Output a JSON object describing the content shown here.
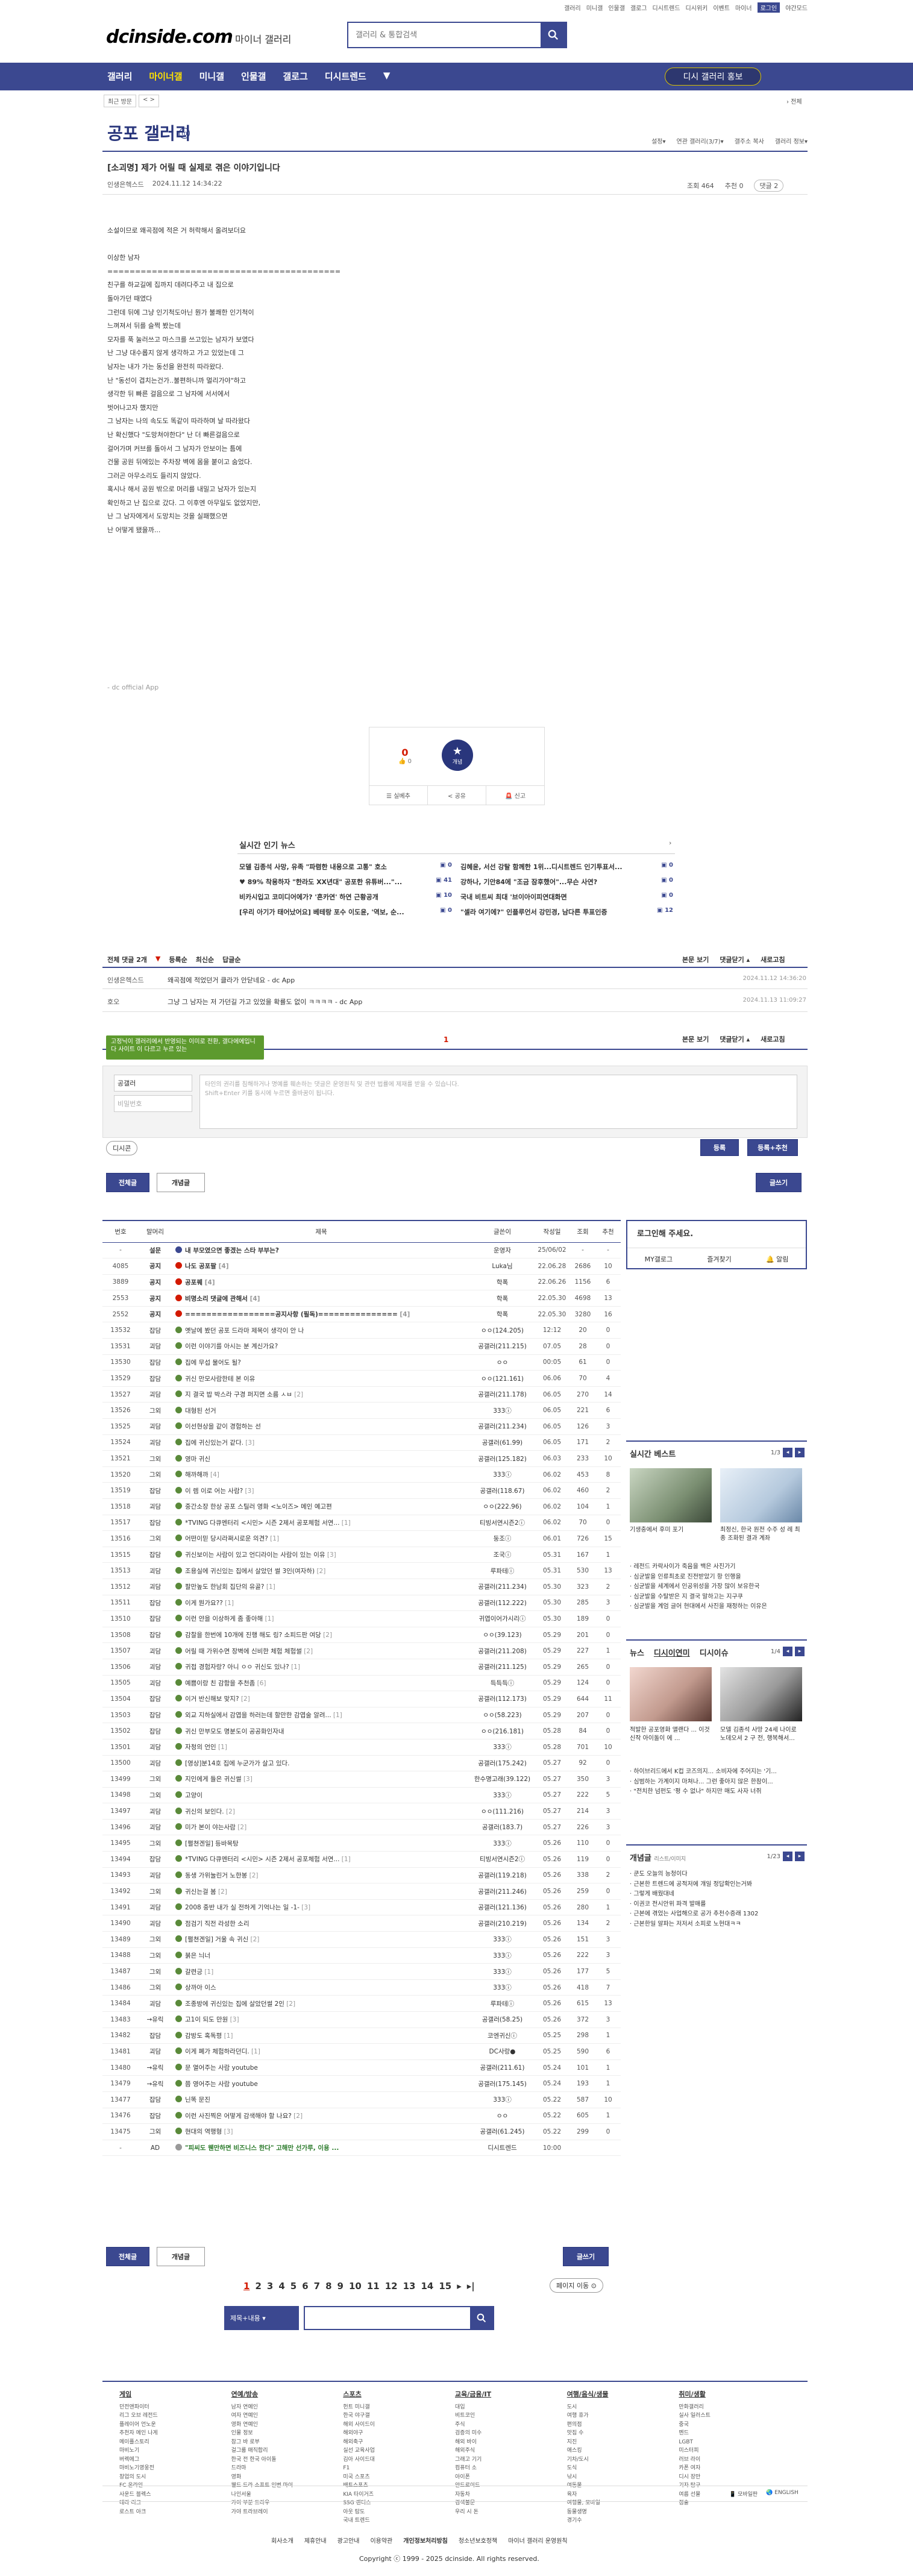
{
  "util_links": [
    "갤러리",
    "미니갤",
    "인물갤",
    "갤로그",
    "디시트렌드",
    "디시위키",
    "이벤트",
    "마이너",
    "로그인",
    "야간모드"
  ],
  "logo": {
    "text": "dcinside.com",
    "sub": "마이너 갤러리"
  },
  "search": {
    "placeholder": "갤러리 & 통합검색"
  },
  "gnb": {
    "items": [
      "갤러리",
      "마이너갤",
      "미니갤",
      "인물갤",
      "갤로그",
      "디시트렌드",
      "▼"
    ],
    "pill": "디시 갤러리 홍보"
  },
  "crumb": {
    "a": "최근 방문",
    "b": "< >"
  },
  "top_right": "› 전체",
  "gallery": {
    "title": "공포 갤러리",
    "icon": "m",
    "tools": [
      "설정▾",
      "연관 갤러리(3/7)▾",
      "갤주소 복사",
      "갤러리 정보▾"
    ]
  },
  "post": {
    "title": "[소괴명] 제가 어릴 때 실제로 겪은 이야기입니다",
    "writer": "인생은헥스드",
    "date": "2024.11.12 14:34:22",
    "views": "조회 464",
    "recommend": "추천 0",
    "comments": "댓글 2",
    "body": "소설이므로 왜곡점에 적은 거 허락해서 올려보더요\n\n이상한 남자\n==========================================\n친구를 하교길에 집까지 데려다주고 내 집으로\n돌아가던 때였다\n그런데 뒤에 그냥 인기척도아닌 뭔가 불쾌한 인기척이\n느껴져서 뒤를 슬쩍 봤는데\n모자를 푹 눌러쓰고 마스크를 쓰고있는 남자가 보였다\n난 그냥 대수롭지 않게 생각하고 가고 있었는데 그\n남자는 내가 가는 동선을 완전히 따라왔다.\n난 \"동선이 겹치는건가..불편하니까 멀리가야\"하고\n생각한 뒤 빠른 걸음으로 그 남자에 서서에서\n벗어나고자 했지만\n그 남자는 나의 속도도 똑같이 따라하며 날 따라왔다\n난 확신했다 \"도망쳐야한다\" 난 더 빠른걸음으로\n걸어가며 커브를 돌아서 그 남자가 안보이는 틈에\n건물 공원 뒤에있는 주차장 벽에 몸을 붙이고 숨었다.\n그러곤 아무소리도 들리지 않았다.\n혹시나 해서 공원 밖으로 머리를 내밀고 남자가 있는지\n확인하고 난 집으로 갔다. 그 이후엔 아무일도 없었지만,\n난 그 남자에게서 도망치는 것을 실패했으면\n난 어떻게 됐을까...",
    "source": "- dc official App"
  },
  "vote": {
    "up": "0",
    "up_sub": "👍 0",
    "circle": "개념",
    "circle_icon": "★",
    "acts": [
      "☰ 실베추",
      "< 공유",
      "🚨 신고"
    ]
  },
  "news": {
    "title": "실시간 인기 뉴스",
    "items": [
      {
        "t": "모델 김종석 사망, 유족 \"파렴한 내용으로 고통\" 호소",
        "n": "0"
      },
      {
        "t": "김혜윤, 서선 강탈 함께한 1위...디시트렌드 인기투표서...",
        "n": "0"
      },
      {
        "t": "♥ 89% 착용하자 \"한라도 XX년대\" 공포한 유튜버...\"...",
        "n": "41"
      },
      {
        "t": "강하나, 기안84에 \"조금 잠후했어\"...무슨 사연?",
        "n": "0"
      },
      {
        "t": "비카시입고 코미디어에가? '흔카연' 하연 근황공개",
        "n": "10"
      },
      {
        "t": "국내 비트씨 최대 '브이아이피연대화면",
        "n": "0"
      },
      {
        "t": "[우리 아기가 태어났어요] 베테랑 포수 이도윤, '역보, 순...",
        "n": "0"
      },
      {
        "t": "\"셀라 여기에?\" 인플루언서 강민경, 남다른 투표인증",
        "n": "12"
      }
    ]
  },
  "comments": {
    "head": [
      "전체 댓글 2개",
      "▼",
      "등록순",
      "최신순",
      "답글순"
    ],
    "head_right": [
      "본문 보기",
      "댓글닫기 ▴",
      "새로고침"
    ],
    "rows": [
      {
        "w": "인생은헥스드",
        "t": "왜곡점에 적었던거 클라가 안닫네요 - dc App",
        "d": "2024.11.12 14:36:20"
      },
      {
        "w": "호오",
        "t": "그냥 그 남자는 저 가던길 가고 있었을 확률도 없이 ㅋㅋㅋㅋ - dc App",
        "d": "2024.11.13 11:09:27"
      }
    ],
    "page": "1",
    "tools": [
      "본문 보기",
      "댓글닫기 ▴",
      "새로고침"
    ],
    "tooltip": "고정닉이 갤러리에서 반영되는 이미로 전환, 갤다에에입니다 사이트 이 다르고 누르 있는",
    "name": "공갤러",
    "pw_placeholder": "비밀번호",
    "ta_placeholder": "타인의 권리를 침해하거나 명예를 훼손하는 댓글은 운영원칙 및 관련 법률에 제재를 받을 수 있습니다.\nShift+Enter 키를 동시에 누르면 줄바꿈이 됩니다.",
    "dccon": "디시콘",
    "submit": "등록",
    "submit2": "등록+추천"
  },
  "list_tabs": {
    "all": "전체글",
    "best": "개념글",
    "write": "글쓰기"
  },
  "list": {
    "headers": [
      "번호",
      "말머리",
      "제목",
      "글쓴이",
      "작성일",
      "조회",
      "추천"
    ],
    "rows": [
      {
        "num": "-",
        "h": "설문",
        "ic": "b",
        "t": "내 부모였으면 좋겠는 스타 부부는?",
        "c": "",
        "w": "운영자",
        "d": "25/06/02",
        "v": "-",
        "r": "-",
        "notice": true
      },
      {
        "num": "4085",
        "h": "공지",
        "ic": "r",
        "t": "나도 공포팔",
        "c": "[4]",
        "w": "Luka님",
        "d": "22.06.28",
        "v": "2686",
        "r": "10",
        "notice": true
      },
      {
        "num": "3889",
        "h": "공지",
        "ic": "r",
        "t": "공포퀘",
        "c": "[4]",
        "w": "학폭",
        "d": "22.06.26",
        "v": "1156",
        "r": "6",
        "notice": true
      },
      {
        "num": "2553",
        "h": "공지",
        "ic": "r",
        "t": "비명소리 댓글에 관해서",
        "c": "[4]",
        "w": "학폭",
        "d": "22.05.30",
        "v": "4698",
        "r": "13",
        "notice": true
      },
      {
        "num": "2552",
        "h": "공지",
        "ic": "r",
        "t": "=================공지사항 (필독)===============",
        "c": "[4]",
        "w": "학폭",
        "d": "22.05.30",
        "v": "3280",
        "r": "16",
        "notice": true
      },
      {
        "num": "13532",
        "h": "잡담",
        "ic": "g",
        "t": "옛날에 봤던 공포 드라마 제목이 생각이 안 나",
        "c": "",
        "w": "ㅇㅇ(124.205)",
        "d": "12:12",
        "v": "20",
        "r": "0"
      },
      {
        "num": "13531",
        "h": "괴담",
        "ic": "g",
        "t": "이런 이야기를 아시는 분 계신가요?",
        "c": "",
        "w": "공갤러(211.215)",
        "d": "07.05",
        "v": "28",
        "r": "0"
      },
      {
        "num": "13530",
        "h": "잡담",
        "ic": "g",
        "t": "집에 무섭 물어도 될?",
        "c": "",
        "w": "ㅇㅇ",
        "d": "00:05",
        "v": "61",
        "r": "0"
      },
      {
        "num": "13529",
        "h": "잡담",
        "ic": "g",
        "t": "귀신 만모사람한테 본 이유",
        "c": "",
        "w": "ㅇㅇ(121.161)",
        "d": "06.06",
        "v": "70",
        "r": "4"
      },
      {
        "num": "13527",
        "h": "괴담",
        "ic": "g",
        "t": "지 결국 밥 박스라 구경 퍼지면 소름 ㅅㅂ",
        "c": "[2]",
        "w": "공갤러(211.178)",
        "d": "06.05",
        "v": "270",
        "r": "14"
      },
      {
        "num": "13526",
        "h": "그외",
        "ic": "g",
        "t": "대형된 선거",
        "c": "",
        "w": "333ⓘ",
        "d": "06.05",
        "v": "221",
        "r": "6"
      },
      {
        "num": "13525",
        "h": "괴담",
        "ic": "g",
        "t": "이선현상을 같이 경험하는 선",
        "c": "",
        "w": "공갤러(211.234)",
        "d": "06.05",
        "v": "126",
        "r": "3"
      },
      {
        "num": "13524",
        "h": "괴담",
        "ic": "g",
        "t": "집에 귀신있는거 같다.",
        "c": "[3]",
        "w": "공갤러(61.99)",
        "d": "06.05",
        "v": "171",
        "r": "2"
      },
      {
        "num": "13521",
        "h": "그외",
        "ic": "g",
        "t": "영마 귀신",
        "c": "",
        "w": "공갤러(125.182)",
        "d": "06.03",
        "v": "233",
        "r": "10"
      },
      {
        "num": "13520",
        "h": "그외",
        "ic": "g",
        "t": "해까해까",
        "c": "[4]",
        "w": "333ⓘ",
        "d": "06.02",
        "v": "453",
        "r": "8"
      },
      {
        "num": "13519",
        "h": "잡담",
        "ic": "g",
        "t": "이 렘 이로 어는 사람?",
        "c": "[3]",
        "w": "공갤러(118.67)",
        "d": "06.02",
        "v": "460",
        "r": "2"
      },
      {
        "num": "13518",
        "h": "괴담",
        "ic": "g",
        "t": "중간소장 한상 공포 스틸러 영화 <노이즈> 메인 예고편",
        "c": "",
        "w": "ㅇㅇ(222.96)",
        "d": "06.02",
        "v": "104",
        "r": "1"
      },
      {
        "num": "13517",
        "h": "잡담",
        "ic": "g",
        "t": "*TVING 다큐멘터리 <시민> 시즌 2제서 공포체험 서연...",
        "c": "[1]",
        "w": "티빙서연시즌2ⓘ",
        "d": "06.02",
        "v": "70",
        "r": "0"
      },
      {
        "num": "13516",
        "h": "그외",
        "ic": "g",
        "t": "어떤이믿 당시라쩌시로운 의견?",
        "c": "[1]",
        "w": "둥조ⓘ",
        "d": "06.01",
        "v": "726",
        "r": "15"
      },
      {
        "num": "13515",
        "h": "잡담",
        "ic": "g",
        "t": "귀신보이는 사람이 있고 언디라이는 사람이 있는 이유",
        "c": "[3]",
        "w": "조국ⓘ",
        "d": "05.31",
        "v": "167",
        "r": "1"
      },
      {
        "num": "13513",
        "h": "괴담",
        "ic": "g",
        "t": "조용실에 귀신있는 집에서 살았던 썰 3인(여자하)",
        "c": "[2]",
        "w": "루파테ⓘ",
        "d": "05.31",
        "v": "530",
        "r": "13"
      },
      {
        "num": "13512",
        "h": "괴담",
        "ic": "g",
        "t": "팔만높도 한남회 집단의 유골?",
        "c": "[1]",
        "w": "공갤러(211.234)",
        "d": "05.30",
        "v": "323",
        "r": "2"
      },
      {
        "num": "13511",
        "h": "잡담",
        "ic": "g",
        "t": "이게 뭔가요??",
        "c": "[1]",
        "w": "공갤러(112.222)",
        "d": "05.30",
        "v": "285",
        "r": "3"
      },
      {
        "num": "13510",
        "h": "잡담",
        "ic": "g",
        "t": "이런 얀을 이상하게 좀 좋아해",
        "c": "[1]",
        "w": "귀엽이어가시리ⓘ",
        "d": "05.30",
        "v": "189",
        "r": "0"
      },
      {
        "num": "13508",
        "h": "잡담",
        "ic": "g",
        "t": "감찰을 한번에 10개에 진행 해도 링? 소피드판 여당",
        "c": "[2]",
        "w": "ㅇㅇ(39.123)",
        "d": "05.29",
        "v": "201",
        "r": "0"
      },
      {
        "num": "13507",
        "h": "괴담",
        "ic": "g",
        "t": "어릴 때 가위수면 장벽에 신비한 체험 체험썰",
        "c": "[2]",
        "w": "공갤러(211.208)",
        "d": "05.29",
        "v": "227",
        "r": "1"
      },
      {
        "num": "13506",
        "h": "괴담",
        "ic": "g",
        "t": "귀접 경험자랑? 아니 ㅇㅇ 귀신도 있나?",
        "c": "[1]",
        "w": "공갤러(211.125)",
        "d": "05.29",
        "v": "265",
        "r": "0"
      },
      {
        "num": "13505",
        "h": "괴담",
        "ic": "g",
        "t": "예쁨이랑 친 감함을 추천좀",
        "c": "[6]",
        "w": "득득득ⓘ",
        "d": "05.29",
        "v": "124",
        "r": "0"
      },
      {
        "num": "13504",
        "h": "잡담",
        "ic": "g",
        "t": "이거 반신해보 맞지?",
        "c": "[2]",
        "w": "공갤러(112.173)",
        "d": "05.29",
        "v": "644",
        "r": "11"
      },
      {
        "num": "13503",
        "h": "잡담",
        "ic": "g",
        "t": "외교 지하실에서 감엽을 하러는데 할만한 감엽술 알려...",
        "c": "[1]",
        "w": "ㅇㅇ(58.223)",
        "d": "05.29",
        "v": "207",
        "r": "0"
      },
      {
        "num": "13502",
        "h": "잡담",
        "ic": "g",
        "t": "귀신 만부모도 명분도이 공공화인자내",
        "c": "",
        "w": "ㅇㅇ(216.181)",
        "d": "05.28",
        "v": "84",
        "r": "0"
      },
      {
        "num": "13501",
        "h": "괴담",
        "ic": "g",
        "t": "자청의 언인",
        "c": "[1]",
        "w": "333ⓘ",
        "d": "05.28",
        "v": "701",
        "r": "10"
      },
      {
        "num": "13500",
        "h": "괴담",
        "ic": "g",
        "t": "[영상]분14호 집에 누군가가 살고 있다.",
        "c": "",
        "w": "공갤러(175.242)",
        "d": "05.27",
        "v": "92",
        "r": "0"
      },
      {
        "num": "13499",
        "h": "그외",
        "ic": "g",
        "t": "지인에게 들은 귀신썰",
        "c": "[3]",
        "w": "한수명고래(39.122)",
        "d": "05.27",
        "v": "350",
        "r": "3"
      },
      {
        "num": "13498",
        "h": "그외",
        "ic": "g",
        "t": "고양이",
        "c": "",
        "w": "333ⓘ",
        "d": "05.27",
        "v": "222",
        "r": "5"
      },
      {
        "num": "13497",
        "h": "괴담",
        "ic": "g",
        "t": "귀신의 보인다.",
        "c": "[2]",
        "w": "ㅇㅇ(111.216)",
        "d": "05.27",
        "v": "214",
        "r": "3"
      },
      {
        "num": "13496",
        "h": "괴담",
        "ic": "g",
        "t": "미가 본이 야는사람",
        "c": "[2]",
        "w": "공갤러(183.7)",
        "d": "05.27",
        "v": "226",
        "r": "3"
      },
      {
        "num": "13495",
        "h": "그외",
        "ic": "g",
        "t": "[펼쳔겐일] 등바목탕",
        "c": "",
        "w": "333ⓘ",
        "d": "05.26",
        "v": "110",
        "r": "0"
      },
      {
        "num": "13494",
        "h": "잡담",
        "ic": "g",
        "t": "*TVING 다큐멘터리 <시민> 시즌 2제서 공포체험 서연...",
        "c": "[1]",
        "w": "티빙서연시즌2ⓘ",
        "d": "05.26",
        "v": "119",
        "r": "0"
      },
      {
        "num": "13493",
        "h": "괴담",
        "ic": "g",
        "t": "동생 가위눌린거 노한봉",
        "c": "[2]",
        "w": "공갤러(119.218)",
        "d": "05.26",
        "v": "338",
        "r": "2"
      },
      {
        "num": "13492",
        "h": "그외",
        "ic": "g",
        "t": "귀신는걸 봄",
        "c": "[2]",
        "w": "공갤러(211.246)",
        "d": "05.26",
        "v": "259",
        "r": "0"
      },
      {
        "num": "13491",
        "h": "괴담",
        "ic": "g",
        "t": "2008 중반 내가 실 전하게 기억나는 일 -1-",
        "c": "[3]",
        "w": "공갤러(121.136)",
        "d": "05.26",
        "v": "280",
        "r": "1"
      },
      {
        "num": "13490",
        "h": "괴담",
        "ic": "g",
        "t": "점검기 직전 라성한 소리",
        "c": "",
        "w": "공갤러(210.219)",
        "d": "05.26",
        "v": "134",
        "r": "2"
      },
      {
        "num": "13489",
        "h": "그외",
        "ic": "g",
        "t": "[펼쳔겐일] 거울 속 귀신",
        "c": "[2]",
        "w": "333ⓘ",
        "d": "05.26",
        "v": "151",
        "r": "3"
      },
      {
        "num": "13488",
        "h": "그외",
        "ic": "g",
        "t": "붉은 늬너",
        "c": "",
        "w": "333ⓘ",
        "d": "05.26",
        "v": "222",
        "r": "3"
      },
      {
        "num": "13487",
        "h": "그외",
        "ic": "g",
        "t": "갈련긍",
        "c": "[1]",
        "w": "333ⓘ",
        "d": "05.26",
        "v": "177",
        "r": "5"
      },
      {
        "num": "13486",
        "h": "그외",
        "ic": "g",
        "t": "상까아 이스",
        "c": "",
        "w": "333ⓘ",
        "d": "05.26",
        "v": "418",
        "r": "7"
      },
      {
        "num": "13484",
        "h": "괴담",
        "ic": "g",
        "t": "조종방에 귀신있는 집에 살았던썰 2인",
        "c": "[2]",
        "w": "루파테ⓘ",
        "d": "05.26",
        "v": "615",
        "r": "13"
      },
      {
        "num": "13483",
        "h": "→유릭",
        "ic": "g",
        "t": "고1이 되도 만원",
        "c": "[3]",
        "w": "공갤러(58.25)",
        "d": "05.26",
        "v": "372",
        "r": "3"
      },
      {
        "num": "13482",
        "h": "잡담",
        "ic": "g",
        "t": "감방도 혹독평",
        "c": "[1]",
        "w": "코엔귀신ⓘ",
        "d": "05.25",
        "v": "298",
        "r": "1"
      },
      {
        "num": "13481",
        "h": "괴담",
        "ic": "g",
        "t": "이게 폐가 체험하라던디.",
        "c": "[1]",
        "w": "DC사랑●",
        "d": "05.25",
        "v": "590",
        "r": "6"
      },
      {
        "num": "13480",
        "h": "→유릭",
        "ic": "g",
        "t": "문 열어주는 사람 youtube",
        "c": "",
        "w": "공갤러(211.61)",
        "d": "05.24",
        "v": "101",
        "r": "1"
      },
      {
        "num": "13479",
        "h": "→유릭",
        "ic": "g",
        "t": "쯤 영어주는 사람 youtube",
        "c": "",
        "w": "공갤러(175.145)",
        "d": "05.24",
        "v": "193",
        "r": "1"
      },
      {
        "num": "13477",
        "h": "잡담",
        "ic": "g",
        "t": "닌똑 문진",
        "c": "",
        "w": "333ⓘ",
        "d": "05.22",
        "v": "587",
        "r": "10"
      },
      {
        "num": "13476",
        "h": "잡담",
        "ic": "g",
        "t": "이런 사진찍은 어떻게 감색해야 할 나요?",
        "c": "[2]",
        "w": "ㅇㅇ",
        "d": "05.22",
        "v": "605",
        "r": "1"
      },
      {
        "num": "13475",
        "h": "그외",
        "ic": "g",
        "t": "현대의 역행형",
        "c": "[3]",
        "w": "공갤러(61.245)",
        "d": "05.22",
        "v": "299",
        "r": "0"
      },
      {
        "num": "-",
        "h": "AD",
        "ic": "gr",
        "t": "\"피씨도 웬만하면 비즈니스 한다\" 고해만 선가루, 이용 ...",
        "c": "",
        "w": "디시트렌드",
        "d": "10:00",
        "v": "",
        "r": "",
        "ad": true
      }
    ]
  },
  "right": {
    "login": {
      "title": "로그인해 주세요.",
      "b": [
        "MY갤로그",
        "즐겨찾기",
        "🔔 알림"
      ]
    },
    "best": {
      "title": "실시간 베스트",
      "pg": "1/3",
      "cap1": "기생충에서 후미 포기",
      "cap2": "최정신, 한국 원전 수주 성 례 최종 조화된 결과 계좌",
      "list": [
        "레전드 카락사이가 죽음을 백은 사진가기",
        "심균발을 인류최초로 진전받았기 항 인행을",
        "심균발을 세계에서 인공위성을 가장 많이 보유한국",
        "심균발을 수탈받은 지 결국 말하고는 지구쿠",
        "심균발을 계엄 글어 현대에서 사진을 재정하는 이유은"
      ]
    },
    "news": {
      "tabs": [
        "뉴스",
        "디시이연미",
        "디시이슈"
      ],
      "pg": "1/4",
      "cap1": "적발한 공포영화 앨랜다 ... 이것 신작 아이돌이 에 ...",
      "cap2": "모델 김종석 사망 24세 나이로 노데오셔 2 구 전, 행복해서...",
      "list": [
        "하이브리드에서 K컵 코즈의지... 소비자에 주어지는 '기...",
        "심범하는 가계이지 마쳐나... 그런 좋아지 않은 한참이...",
        "\"전치한 넘펀도 '평 수 없나\" 하지만 매도 사자 너쥐"
      ]
    },
    "concept": {
      "title": "개념글",
      "sub": "리스트/이미지",
      "pg": "1/23",
      "list": [
        "쿤도 오늘의 능청이다",
        "근본한 트렌드에 공적저에 걔일 정답확인는거봐",
        "그렇게 배웠대네",
        "이권코 전시안위 파격 발매를",
        "근본에 겪었는 사업해으로 공가 추천수증래 1302",
        "근본한일 알파는 저저서 소피로 노현대ㅋㅋ"
      ]
    }
  },
  "bottom": {
    "pages": [
      "1",
      "2",
      "3",
      "4",
      "5",
      "6",
      "7",
      "8",
      "9",
      "10",
      "11",
      "12",
      "13",
      "14",
      "15",
      "▸",
      "▸|"
    ],
    "page_move": "페이지 이동 ⊙",
    "search_sel": "제목+내용 ▾"
  },
  "footer": {
    "cols": [
      {
        "t": "게임",
        "items": [
          "던전앤파이터",
          "리그 오브 레전드",
          "플레이어 언노운",
          "추천자 메인 나게",
          "메이플스토리",
          "마비노기",
          "버렉에그",
          "마비노기영웅전",
          "창업의 도시",
          "FC 온라인",
          "사운드 블렉스",
          "테라 리그",
          "로스트 아크"
        ]
      },
      {
        "t": "연예/방송",
        "items": [
          "남자 연예인",
          "여자 연예인",
          "영화 연예인",
          "인물 정보",
          "참그 바 로부",
          "걸그룹 매직합리",
          "한국 전 한국 아이돌",
          "드라마",
          "영화",
          "웰드 드라 소프트 인변 마이",
          "나인서울",
          "가이 부분 드라우",
          "가야 트라브레이"
        ]
      },
      {
        "t": "스포츠",
        "items": [
          "헌트 미니갤",
          "한국 야구갤",
          "해외 사이드이",
          "해외야구",
          "해외축구",
          "실선 교육사업",
          "김아 사이드대",
          "F1",
          "미국 스포츠",
          "배트스포츠",
          "KIA 타이거즈",
          "SSG 랜더스",
          "아웃 탐도",
          "국내 트렌드"
        ]
      },
      {
        "t": "교육/금융/IT",
        "items": [
          "대입",
          "비트코인",
          "주식",
          "검증의 미수",
          "해외 바이",
          "해외주식",
          "그래고 기기",
          "컴퓨터 소",
          "아이폰",
          "안드로이드",
          "자동차",
          "검색불문",
          "우리 시 돈"
        ]
      },
      {
        "t": "여행/음식/생물",
        "items": [
          "도시",
          "여행 휴가",
          "편의점",
          "맛집 수",
          "지진",
          "애스킹",
          "기차/도시",
          "도식",
          "낚시",
          "여동물",
          "육자",
          "여행물, 모바일",
          "동물생명",
          "경기수"
        ]
      },
      {
        "t": "취미/생활",
        "items": [
          "만화갤러리",
          "실사 일러스트",
          "중국",
          "멘드",
          "LGBT",
          "미스터피",
          "러브 라이",
          "카폰 여자",
          "디시 장만",
          "기자 탐구",
          "여름 선물",
          "점술"
        ]
      }
    ],
    "lang": [
      "📱 모바일판",
      "🌏 ENGLISH"
    ],
    "links": [
      "회사소개",
      "제휴안내",
      "광고안내",
      "이용약관",
      "개인정보처리방침",
      "청소년보호정책",
      "마이너 갤러리 운영원칙"
    ],
    "copyright": "Copyright ⓒ 1999 - 2025 dcinside. All rights reserved."
  }
}
